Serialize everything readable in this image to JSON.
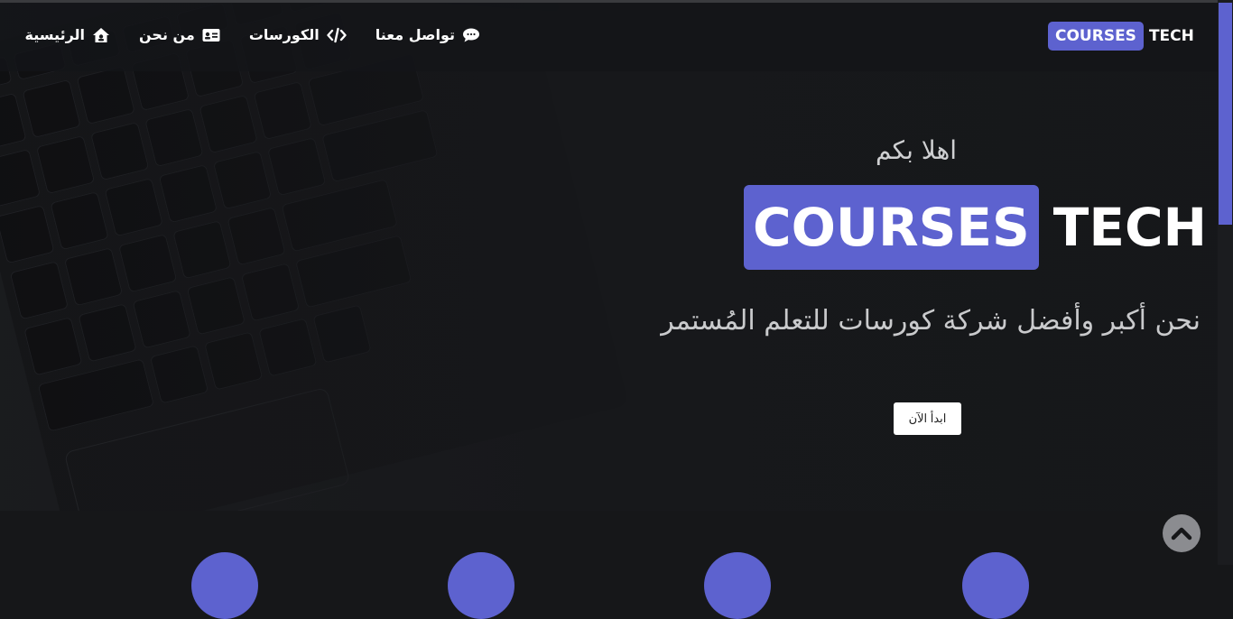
{
  "navbar": {
    "logo": {
      "badge": "COURSES",
      "word": "TECH"
    },
    "items": [
      {
        "label": "الرئيسية",
        "icon": "home-icon"
      },
      {
        "label": "من نحن",
        "icon": "id-card-icon"
      },
      {
        "label": "الكورسات",
        "icon": "code-icon"
      },
      {
        "label": "تواصل معنا",
        "icon": "chat-icon"
      }
    ]
  },
  "hero": {
    "greeting": "اهلا بكم",
    "logo": {
      "badge": "COURSES",
      "word": "TECH"
    },
    "tagline": "نحن أكبر وأفضل شركة كورسات للتعلم المُستمر",
    "start_button": "ابدأ الآن"
  },
  "colors": {
    "accent": "#5d62cf",
    "background": "#161719",
    "to_top_button": "#8b8c90"
  },
  "back_to_top_icon": "chevron-up-icon"
}
